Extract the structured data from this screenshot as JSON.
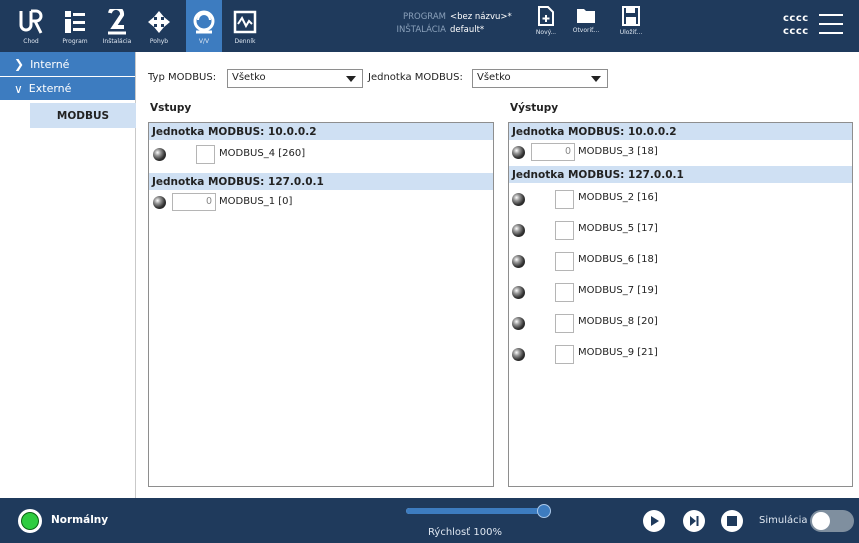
{
  "colors": {
    "topbar": "#1f3a5c",
    "accent": "#3d7cc0",
    "group_header": "#cfe0f3",
    "status_ok": "#2ecc40"
  },
  "header": {
    "nav": [
      {
        "label": "Chod",
        "icon": "ur-logo-icon",
        "active": false
      },
      {
        "label": "Program",
        "icon": "program-icon",
        "active": false
      },
      {
        "label": "Inštalácia",
        "icon": "installation-icon",
        "active": false
      },
      {
        "label": "Pohyb",
        "icon": "move-icon",
        "active": false
      },
      {
        "label": "V/V",
        "icon": "io-icon",
        "active": true
      },
      {
        "label": "Denník",
        "icon": "log-icon",
        "active": false
      }
    ],
    "program_label": "PROGRAM",
    "program_value": "<bez názvu>*",
    "installation_label": "INŠTALÁCIA",
    "installation_value": "default*",
    "file_buttons": [
      {
        "label": "Nový...",
        "icon": "new-file-icon"
      },
      {
        "label": "Otvoriť...",
        "icon": "open-folder-icon"
      },
      {
        "label": "Uložiť...",
        "icon": "save-icon"
      }
    ],
    "user_line1": "cccc",
    "user_line2": "cccc"
  },
  "sidebar": {
    "items": [
      {
        "label": "Interné",
        "chevron": ">"
      },
      {
        "label": "Externé",
        "chevron": "v"
      }
    ],
    "sub_item": "MODBUS"
  },
  "filters": {
    "type_label": "Typ MODBUS:",
    "type_value": "Všetko",
    "unit_label": "Jednotka MODBUS:",
    "unit_value": "Všetko"
  },
  "inputs": {
    "title": "Vstupy",
    "groups": [
      {
        "header": "Jednotka MODBUS: 10.0.0.2",
        "signals": [
          {
            "kind": "checkbox",
            "label": "MODBUS_4 [260]"
          }
        ]
      },
      {
        "header": "Jednotka MODBUS: 127.0.0.1",
        "signals": [
          {
            "kind": "number",
            "value": "0",
            "label": "MODBUS_1 [0]"
          }
        ]
      }
    ]
  },
  "outputs": {
    "title": "Výstupy",
    "groups": [
      {
        "header": "Jednotka MODBUS: 10.0.0.2",
        "signals": [
          {
            "kind": "number",
            "value": "0",
            "label": "MODBUS_3 [18]"
          }
        ]
      },
      {
        "header": "Jednotka MODBUS: 127.0.0.1",
        "signals": [
          {
            "kind": "checkbox",
            "label": "MODBUS_2 [16]"
          },
          {
            "kind": "checkbox",
            "label": "MODBUS_5 [17]"
          },
          {
            "kind": "checkbox",
            "label": "MODBUS_6 [18]"
          },
          {
            "kind": "checkbox",
            "label": "MODBUS_7 [19]"
          },
          {
            "kind": "checkbox",
            "label": "MODBUS_8 [20]"
          },
          {
            "kind": "checkbox",
            "label": "MODBUS_9 [21]"
          }
        ]
      }
    ]
  },
  "footer": {
    "status": "Normálny",
    "speed_label": "Rýchlosť 100%",
    "speed_fraction": 1.0,
    "controls": [
      "play-icon",
      "step-icon",
      "stop-icon"
    ],
    "simulation_label": "Simulácia",
    "simulation_on": false
  }
}
